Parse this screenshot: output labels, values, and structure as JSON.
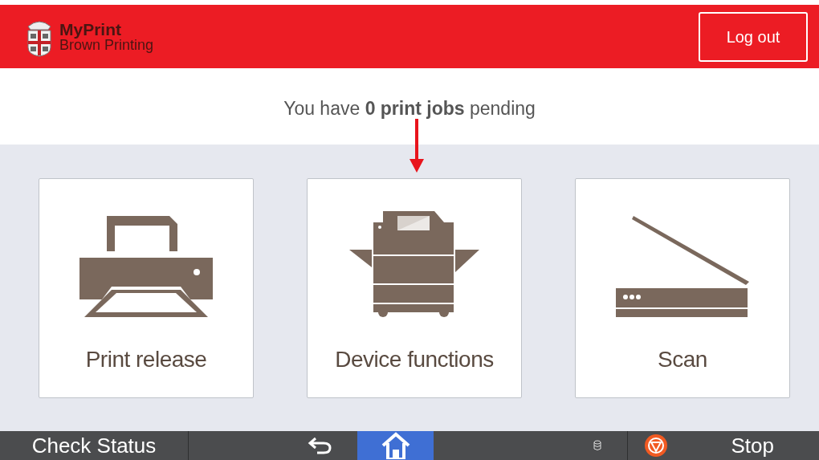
{
  "header": {
    "title": "MyPrint",
    "subtitle": "Brown Printing",
    "logout": "Log out"
  },
  "message": "You have **0 print jobs** pending",
  "tiles": [
    {
      "kind": "printer",
      "label": "Print release"
    },
    {
      "kind": "copier",
      "label": "Device functions"
    },
    {
      "kind": "scanner",
      "label": "Scan"
    }
  ],
  "bottom_bar": {
    "check_status": "Check Status",
    "nav_buttons": [
      {
        "kind": "back",
        "selected": false
      },
      {
        "kind": "home",
        "selected": true
      }
    ],
    "stop": "Stop"
  }
}
